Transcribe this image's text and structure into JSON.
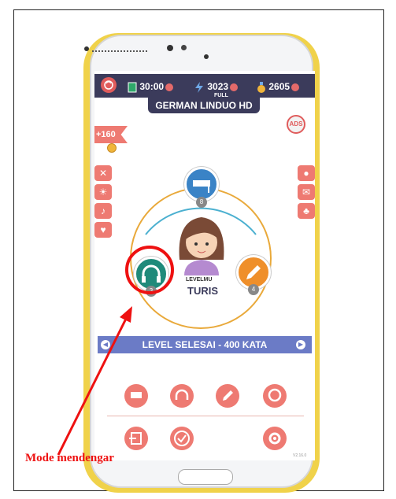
{
  "topbar": {
    "energy": "30:00",
    "gems": "3023",
    "gems_badge": "FULL",
    "coins": "2605"
  },
  "lang_title": "GERMAN LINDUO HD",
  "ads_label": "ADS",
  "bonus": "+160",
  "modes": {
    "learn_count": "8",
    "listen_count": "3",
    "write_count": "4"
  },
  "level": {
    "label": "LEVELMU",
    "value": "TURIS"
  },
  "level_bar": "LEVEL SELESAI - 400 KATA",
  "version": "V2.16.0",
  "annotation": {
    "caption": "Mode mendengar",
    "arrow_color": "#ee1111"
  },
  "colors": {
    "topbar": "#3b3b5b",
    "accent_red": "#ee7a72",
    "learn_blue": "#3a83c6",
    "listen_teal": "#1f8a7a",
    "write_orange": "#ef8f2a"
  }
}
